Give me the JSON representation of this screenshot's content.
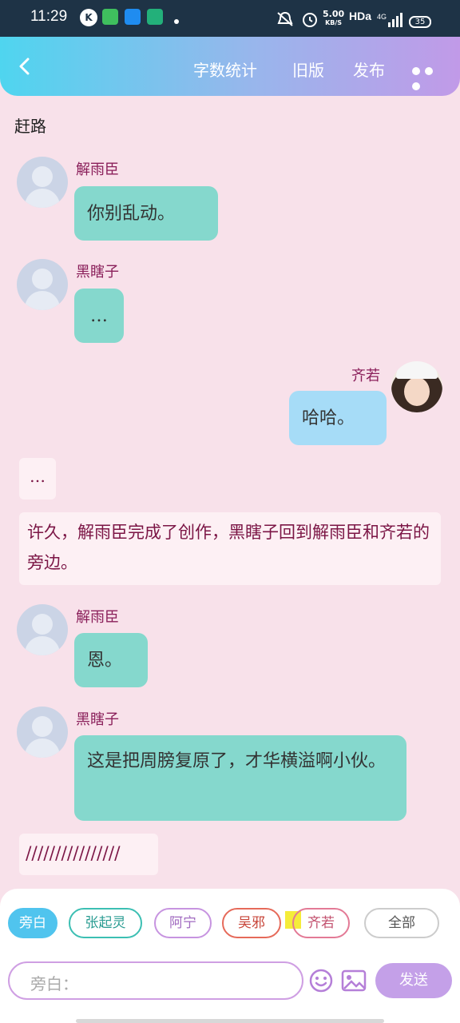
{
  "status_bar": {
    "time": "11:29",
    "speed_value": "5.00",
    "speed_unit": "KB/S",
    "network": "HDa",
    "signal": "4G",
    "battery": "35"
  },
  "header": {
    "word_count_label": "字数统计",
    "old_version_label": "旧版",
    "publish_label": "发布"
  },
  "chat": {
    "title": "赶路",
    "messages": [
      {
        "name": "解雨臣",
        "text": "你别乱动。"
      },
      {
        "name": "黑瞎子",
        "text": "…"
      },
      {
        "name": "齐若",
        "text": "哈哈。"
      },
      {
        "text": "…"
      },
      {
        "text": "许久，解雨臣完成了创作，黑瞎子回到解雨臣和齐若的旁边。"
      },
      {
        "name": "解雨臣",
        "text": "恩。"
      },
      {
        "name": "黑瞎子",
        "text": "这是把周膀复原了，才华横溢啊小伙。"
      },
      {
        "text": "////////////////"
      }
    ]
  },
  "bottom": {
    "chips": [
      "旁白",
      "张起灵",
      "阿宁",
      "吴邪",
      "齐若",
      "全部"
    ],
    "input_placeholder": "旁白：",
    "send_label": "发送"
  },
  "colors": {
    "background": "#f8e1ea",
    "bubble_teal": "#85d8cd",
    "bubble_blue": "#a6dcf7",
    "name_color": "#8a1f5a",
    "send_button": "#c4a0e8"
  }
}
